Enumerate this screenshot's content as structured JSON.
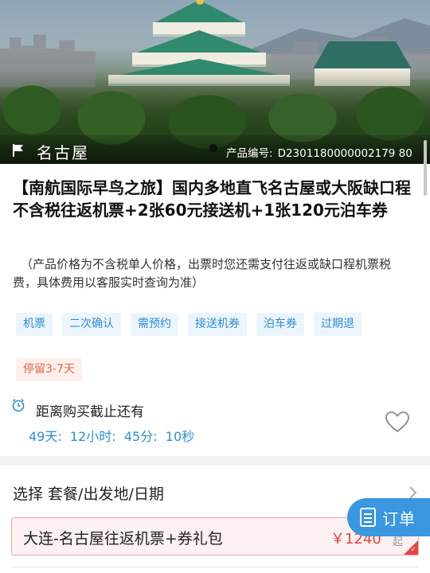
{
  "hero": {
    "destination": "名古屋",
    "product_code_label": "产品编号:",
    "product_code": "D2301180000002179 80"
  },
  "product": {
    "title": "【南航国际早鸟之旅】国内多地直飞名古屋或大阪缺口程不含税往返机票+2张60元接送机+1张120元泊车券",
    "note": "（产品价格为不含税单人价格，出票时您还需支付往返或缺口程机票税费，具体费用以客服实时查询为准）"
  },
  "tags": [
    "机票",
    "二次确认",
    "需预约",
    "接送机券",
    "泊车券",
    "过期退"
  ],
  "warn_tag": "停留3-7天",
  "deadline": {
    "label": "距离购买截止还有",
    "countdown": "49天:  12小时:  45分:  10秒"
  },
  "selection": {
    "label": "选择 套餐/出发地/日期"
  },
  "package": {
    "name": "大连-名古屋往返机票+券礼包",
    "price": "￥1240",
    "suffix": "起",
    "check": "✓"
  },
  "order_button": {
    "label": "订单"
  },
  "colors": {
    "accent_blue": "#2b8fd6",
    "price_red": "#e8443d",
    "order_button": "#3a97e0"
  },
  "icons": [
    "flag-icon",
    "clock-icon",
    "heart-icon",
    "chevron-right-icon",
    "order-doc-icon"
  ]
}
